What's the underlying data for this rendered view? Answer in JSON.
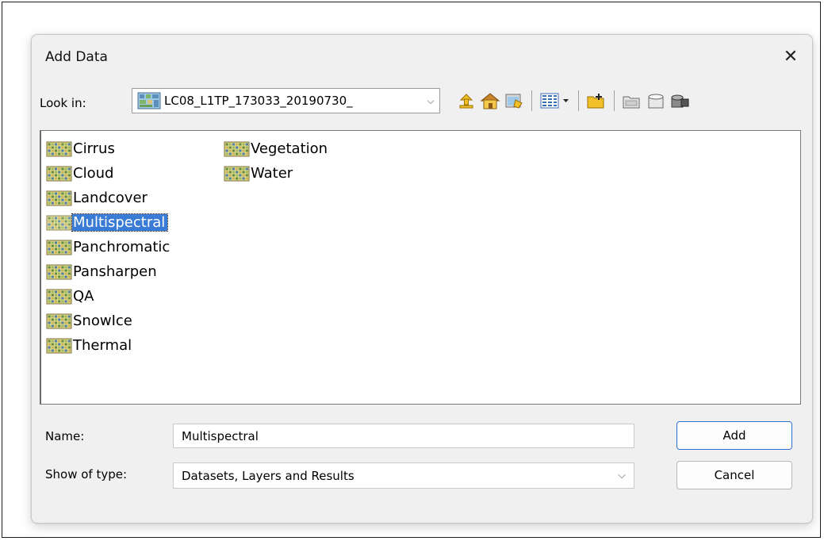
{
  "dialog": {
    "title": "Add Data",
    "close_glyph": "✕"
  },
  "look_in": {
    "label": "Look in:",
    "value": "LC08_L1TP_173033_20190730_",
    "dropdown_glyph": "⌵"
  },
  "toolbar": {
    "buttons": [
      {
        "name": "up-one-level-icon"
      },
      {
        "name": "home-icon"
      },
      {
        "name": "connect-to-folder-icon"
      },
      {
        "name": "view-options-icon"
      },
      {
        "name": "new-folder-icon"
      },
      {
        "name": "new-file-geodatabase-icon"
      },
      {
        "name": "new-personal-geodatabase-icon"
      },
      {
        "name": "new-database-connection-icon"
      }
    ]
  },
  "files": {
    "column1": [
      "Cirrus",
      "Cloud",
      "Landcover",
      "Multispectral",
      "Panchromatic",
      "Pansharpen",
      "QA",
      "SnowIce",
      "Thermal"
    ],
    "column2": [
      "Vegetation",
      "Water"
    ],
    "selected": "Multispectral"
  },
  "form": {
    "name_label": "Name:",
    "name_value": "Multispectral",
    "type_label": "Show of type:",
    "type_value": "Datasets, Layers and Results",
    "type_dropdown_glyph": "⌵"
  },
  "buttons": {
    "add": "Add",
    "cancel": "Cancel"
  },
  "colors": {
    "selection": "#3a7bd5",
    "dialog_bg": "#f0f0f0",
    "default_button_border": "#2a6fd1"
  }
}
